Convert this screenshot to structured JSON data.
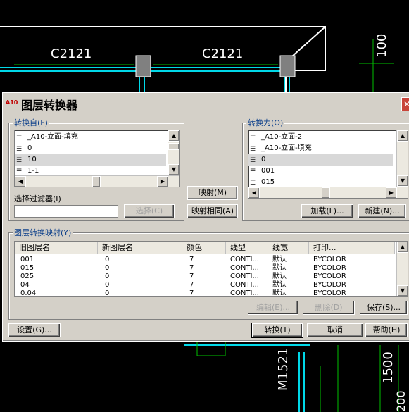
{
  "cad": {
    "label_c2121_left": "C2121",
    "label_c2121_right": "C2121",
    "label_100": "100",
    "label_m1521": "M1521",
    "label_1500": "1500",
    "label_200": "200"
  },
  "dialog": {
    "title": "图层转换器",
    "app_icon": "A10",
    "close_glyph": "✕",
    "convert_from": {
      "label": "转换自(F)",
      "items": [
        {
          "icon": "layers-icon",
          "name": "_A10-立面-填充"
        },
        {
          "icon": "layers-icon",
          "name": "0"
        },
        {
          "icon": "layers-icon",
          "name": "10"
        },
        {
          "icon": "layers-icon",
          "name": "1-1"
        }
      ]
    },
    "filter_label": "选择过滤器(I)",
    "filter_value": "",
    "select_button": "选择(C)",
    "map_button": "映射(M)",
    "map_same_button": "映射相同(A)",
    "convert_to": {
      "label": "转换为(O)",
      "items": [
        {
          "icon": "layers-icon",
          "name": "_A10-立面-2"
        },
        {
          "icon": "layers-icon",
          "name": "_A10-立面-填充"
        },
        {
          "icon": "layers-icon",
          "name": "0"
        },
        {
          "icon": "layers-icon",
          "name": "001"
        },
        {
          "icon": "layers-icon",
          "name": "015"
        }
      ]
    },
    "load_button": "加载(L)...",
    "new_button": "新建(N)...",
    "mappings": {
      "label": "图层转换映射(Y)",
      "columns": [
        "旧图层名",
        "新图层名",
        "颜色",
        "线型",
        "线宽",
        "打印..."
      ],
      "rows": [
        [
          "001",
          "0",
          "7",
          "CONTI...",
          "默认",
          "BYCOLOR"
        ],
        [
          "015",
          "0",
          "7",
          "CONTI...",
          "默认",
          "BYCOLOR"
        ],
        [
          "025",
          "0",
          "7",
          "CONTI...",
          "默认",
          "BYCOLOR"
        ],
        [
          "04",
          "0",
          "7",
          "CONTI...",
          "默认",
          "BYCOLOR"
        ],
        [
          "0.04",
          "0",
          "7",
          "CONTI...",
          "默认",
          "BYCOLOR"
        ]
      ]
    },
    "edit_button": "编辑(E)...",
    "delete_button": "删除(D)",
    "save_button": "保存(S)...",
    "settings_button": "设置(G)...",
    "convert_button": "转换(T)",
    "cancel_button": "取消",
    "help_button": "帮助(H)"
  }
}
